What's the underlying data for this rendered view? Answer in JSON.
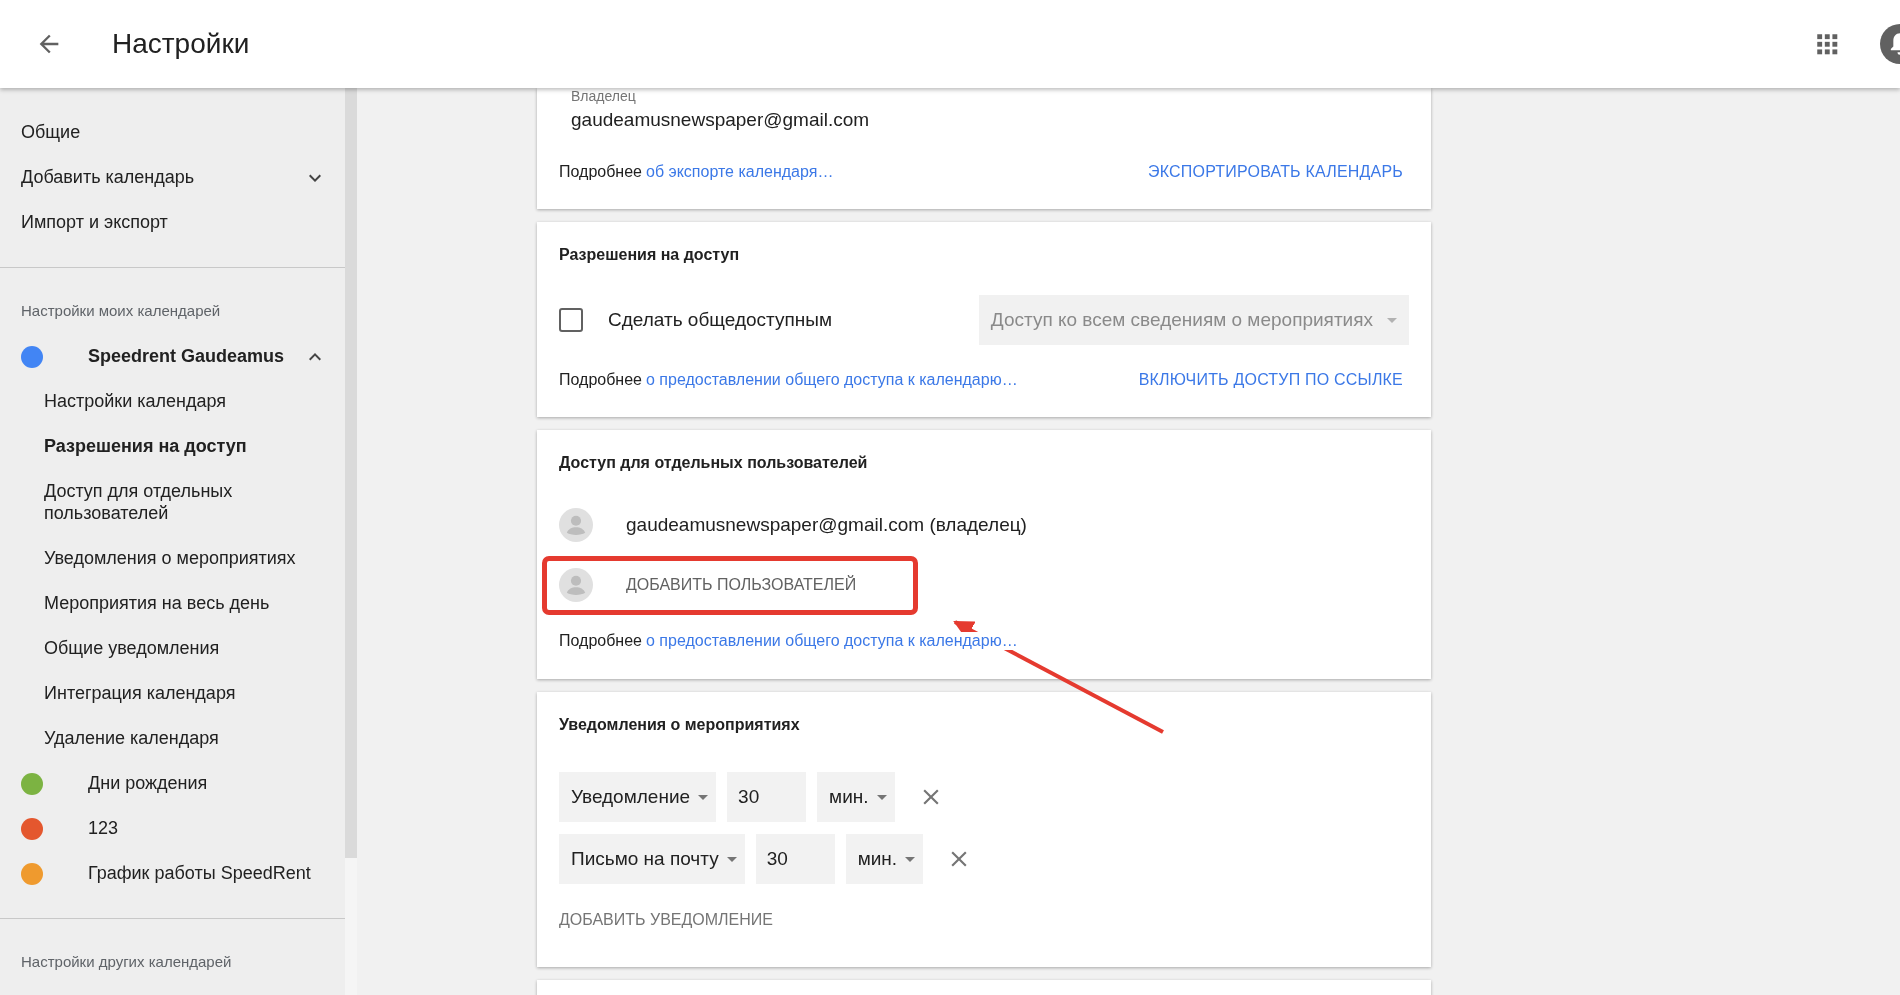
{
  "header": {
    "title": "Настройки"
  },
  "sidebar": {
    "top_items": [
      {
        "label": "Общие"
      },
      {
        "label": "Добавить календарь",
        "expanded": false
      },
      {
        "label": "Импорт и экспорт"
      }
    ],
    "my_heading": "Настройки моих календарей",
    "calendars": [
      {
        "name": "Speedrent Gaudeamus",
        "color": "#4285f4",
        "expanded": true,
        "children": [
          {
            "label": "Настройки календаря",
            "selected": false
          },
          {
            "label": "Разрешения на доступ",
            "selected": true
          },
          {
            "label": "Доступ для отдельных пользователей",
            "selected": false
          },
          {
            "label": "Уведомления о мероприятиях",
            "selected": false
          },
          {
            "label": "Мероприятия на весь день",
            "selected": false
          },
          {
            "label": "Общие уведомления",
            "selected": false
          },
          {
            "label": "Интеграция календаря",
            "selected": false
          },
          {
            "label": "Удаление календаря",
            "selected": false
          }
        ]
      },
      {
        "name": "Дни рождения",
        "color": "#7cb342"
      },
      {
        "name": "123",
        "color": "#e4572e"
      },
      {
        "name": "График работы SpeedRent",
        "color": "#ef9a2e"
      }
    ],
    "other_heading": "Настройки других календарей"
  },
  "export_card": {
    "owner_label": "Владелец",
    "owner": "gaudeamusnewspaper@gmail.com",
    "more_prefix": "Подробнее",
    "more_link": "об экспорте календаря…",
    "action": "ЭКСПОРТИРОВАТЬ КАЛЕНДАРЬ"
  },
  "access_card": {
    "title": "Разрешения на доступ",
    "public_checkbox": {
      "label": "Сделать общедоступным",
      "checked": false
    },
    "access_select": {
      "value": "Доступ ко всем сведениям о мероприятиях",
      "disabled": true
    },
    "more_prefix": "Подробнее",
    "more_link": "о предоставлении общего доступа к календарю…",
    "action": "ВКЛЮЧИТЬ ДОСТУП ПО ССЫЛКЕ"
  },
  "users_card": {
    "title": "Доступ для отдельных пользователей",
    "users": [
      {
        "label": "gaudeamusnewspaper@gmail.com (владелец)"
      }
    ],
    "add_button": "ДОБАВИТЬ ПОЛЬЗОВАТЕЛЕЙ",
    "more_prefix": "Подробнее",
    "more_link": "о предоставлении общего доступа к календарю…"
  },
  "notifications_card": {
    "title": "Уведомления о мероприятиях",
    "rows": [
      {
        "type": "Уведомление",
        "value": "30",
        "unit": "мин."
      },
      {
        "type": "Письмо на почту",
        "value": "30",
        "unit": "мин."
      }
    ],
    "add_button": "ДОБАВИТЬ УВЕДОМЛЕНИЕ"
  }
}
